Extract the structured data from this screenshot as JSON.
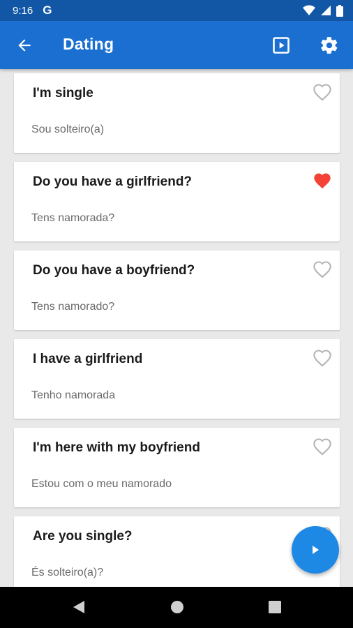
{
  "status_bar": {
    "time": "9:16",
    "google_badge": "G",
    "icons": [
      "wifi-icon",
      "signal-icon",
      "battery-icon"
    ]
  },
  "app_bar": {
    "title": "Dating",
    "icons": [
      "back-arrow-icon",
      "play-box-icon",
      "settings-gear-icon"
    ]
  },
  "phrases": [
    {
      "english": "I'm single",
      "portuguese": "Sou solteiro(a)",
      "favorite": false
    },
    {
      "english": "Do you have a girlfriend?",
      "portuguese": "Tens namorada?",
      "favorite": true
    },
    {
      "english": "Do you have a boyfriend?",
      "portuguese": "Tens namorado?",
      "favorite": false
    },
    {
      "english": "I have a girlfriend",
      "portuguese": "Tenho namorada",
      "favorite": false
    },
    {
      "english": "I'm here with my boyfriend",
      "portuguese": "Estou com o meu namorado",
      "favorite": false
    },
    {
      "english": "Are you single?",
      "portuguese": "És solteiro(a)?",
      "favorite": false
    }
  ],
  "fab": {
    "icon": "play-icon"
  },
  "nav_bar": {
    "icons": [
      "back-triangle-icon",
      "home-circle-icon",
      "recents-square-icon"
    ]
  },
  "colors": {
    "status_bar": "#1257a6",
    "app_bar": "#1a6fd0",
    "fab": "#1e88e5",
    "favorite_heart": "#f44336",
    "empty_heart": "#b5b5b5"
  }
}
